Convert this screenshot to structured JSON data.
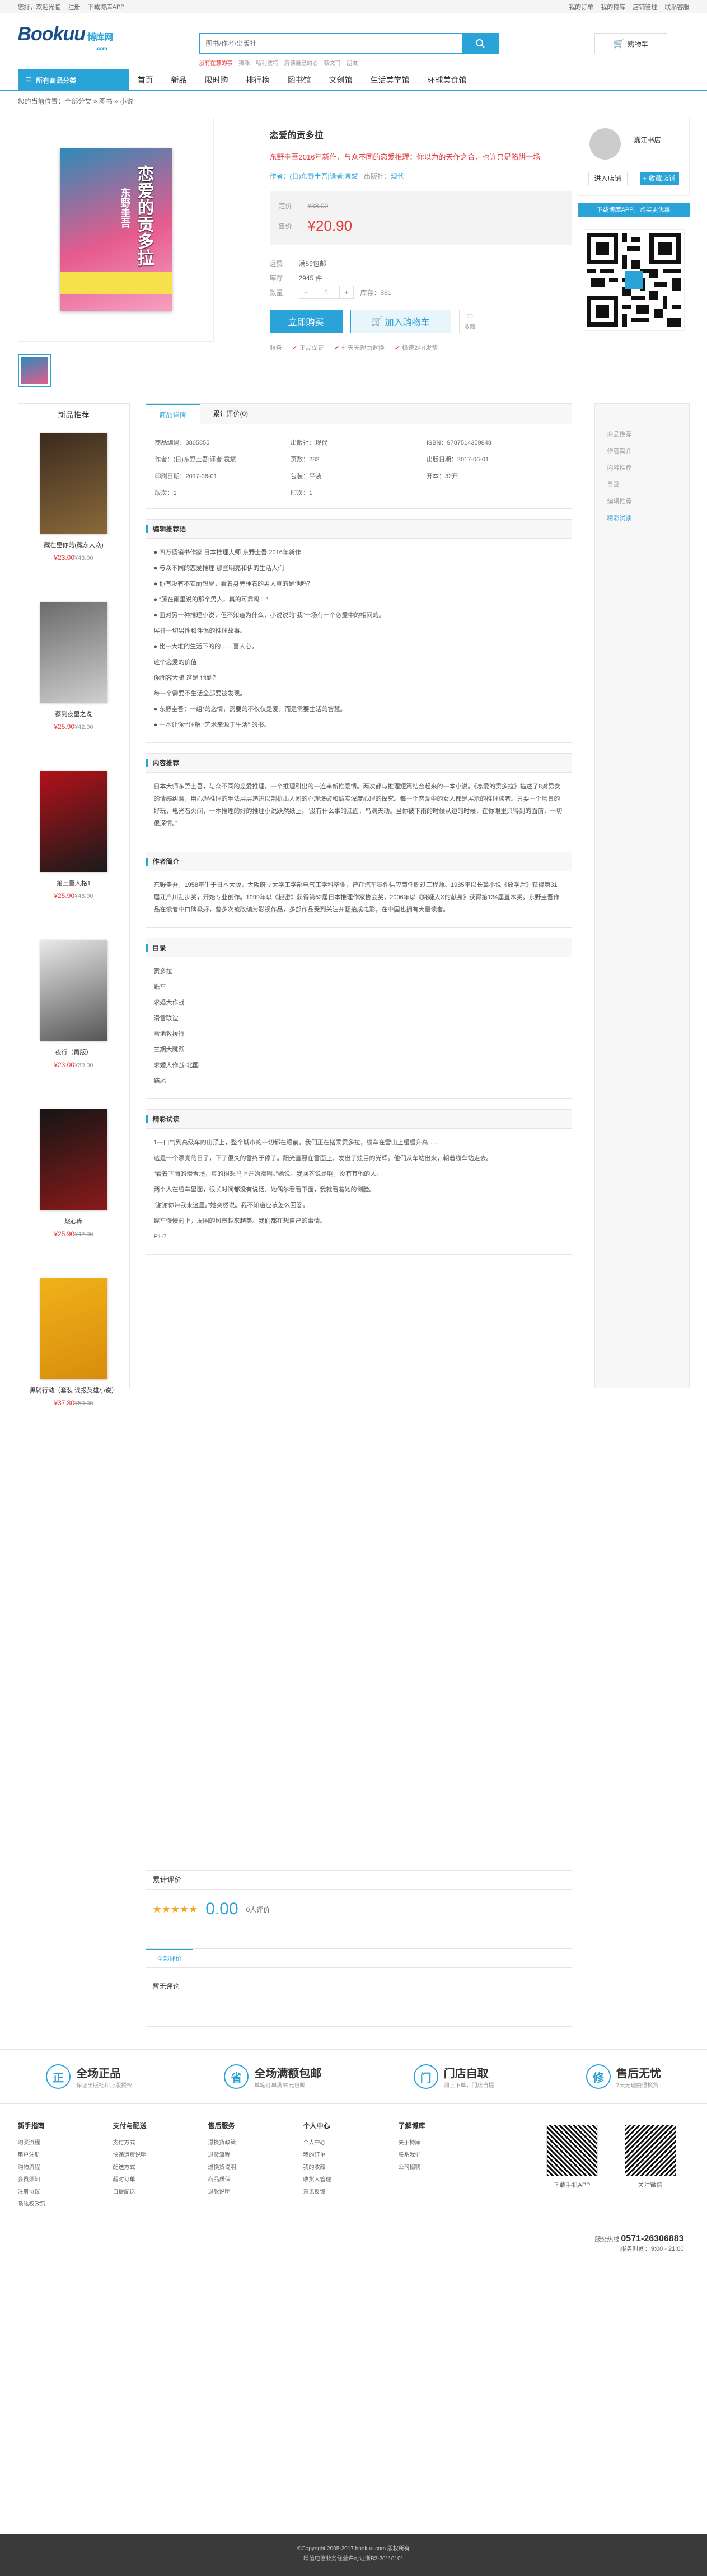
{
  "topbar": {
    "links_left": [
      "您好，欢迎光临",
      "注册",
      "下载博库APP"
    ],
    "links_right": [
      "我的订单",
      "我的博库",
      "店铺管理",
      "联系客服"
    ]
  },
  "header": {
    "logo": "Bookuu",
    "logo_cn": "博库网",
    "logo_sub": ".com",
    "search_placeholder": "图书/作者/出版社",
    "hot_words": [
      "没有在意的事",
      "猫咪",
      "哈利波特",
      "解读自己的心",
      "蔡文甫",
      "朋友"
    ],
    "cart": "购物车"
  },
  "nav": {
    "all": "所有商品分类",
    "items": [
      "首页",
      "新品",
      "限时购",
      "排行榜",
      "图书馆",
      "文创馆",
      "生活美学馆",
      "环球美食馆"
    ]
  },
  "crumb": "您的当前位置：全部分类 » 图书 » 小说",
  "product": {
    "title": "恋爱的贡多拉",
    "desc": "东野圭吾2016年新作，与众不同的恋爱推理：你以为的天作之合，也许只是陷阱一场",
    "author_line": "作者：(日)东野圭吾|译者:袁斌",
    "publisher_label": "出版社：",
    "publisher": "现代",
    "list_label": "定价",
    "list_price": "¥38.00",
    "price_label": "售价",
    "price": "¥20.90",
    "shipping_label": "运费",
    "shipping": "满59包邮",
    "stock_label": "库存",
    "stock": "2945 件",
    "qty_label": "数量",
    "qty": "1",
    "qty_limit": "库存：881",
    "buy": "立即购买",
    "add_cart": "加入购物车",
    "fav": "收藏",
    "svc_label": "服务",
    "services": [
      "正品保证",
      "七天无理由退换",
      "极速24H发货"
    ],
    "cover_title": "恋爱的贡多拉",
    "cover_author": "东野圭吾"
  },
  "shop": {
    "name": "嘉江书店",
    "enter": "进入店铺",
    "follow": "+ 收藏店铺",
    "download": "下载博库APP，购买更优惠"
  },
  "left": {
    "title": "新品推荐",
    "books": [
      {
        "name": "藏在里你的(藏东大众)",
        "price": "¥23.00",
        "orig": "¥43.00",
        "c1": "#3b2a1e",
        "c2": "#8a6a3a"
      },
      {
        "name": "蔡到夜里之说",
        "price": "¥25.90",
        "orig": "¥42.00",
        "c1": "#6b6b6b",
        "c2": "#cfcfcf"
      },
      {
        "name": "第三重人格1",
        "price": "¥25.90",
        "orig": "¥48.00",
        "c1": "#b1121a",
        "c2": "#1a1a1a"
      },
      {
        "name": "夜行（再版）",
        "price": "¥23.00",
        "orig": "¥39.00",
        "c1": "#e9e9e9",
        "c2": "#555555"
      },
      {
        "name": "烧心库",
        "price": "¥25.90",
        "orig": "¥42.00",
        "c1": "#151515",
        "c2": "#8a1a1a"
      },
      {
        "name": "黑骑行动（套装 谍报英雄小说）",
        "price": "¥37.80",
        "orig": "¥59.00",
        "c1": "#f0b21a",
        "c2": "#d88c0c"
      }
    ]
  },
  "tabs": [
    "商品详情",
    "累计评价(0)"
  ],
  "spec": [
    "商品编码：3805855",
    "出版社：现代",
    "ISBN：9787514359848",
    "作者：(日)东野圭吾|译者:袁斌",
    "页数：282",
    "出版日期：2017-06-01",
    "印刷日期：2017-06-01",
    "包装：平装",
    "开本：32开",
    "版次：1",
    "印次：1",
    ""
  ],
  "sections": [
    {
      "title": "编辑推荐语",
      "lines": [
        "● 四万畅销书作家 日本推理大师 东野圭吾 2016年新作",
        "● 与众不同的恋爱推理 那些明亮和伊的生活人们",
        "● 你有没有不安而想醒，看着身旁睡着的男人真的是他吗？",
        "● “藤在雨里说的那个男人，真的可靠吗！”",
        "● 面对另一种推理小说，但不知道为什么，小说说的“我”一场有一个恋爱中的相间的。",
        "    展开一切男性和伴侣的推理故事。",
        "● 比一大堆的生活下的的……喜人心。",
        "这个恋爱的价值",
        "你面客大骗 这是 他到？",
        "每一个需要不生活全部要被发现。",
        "● 东野圭吾：一组*的恋情，需要的不仅仅是爱，而是需要生活的智慧。",
        "● 一本让你**理解 “艺术来源于生活” 的书。"
      ]
    },
    {
      "title": "内容推荐",
      "lines": [
        "日本大师东野圭吾，与众不同的恋爱推理，一个推理引出的一连串新推爱情。两次都与推理短篇结合起来的一本小说。《恋爱的贡多拉》描述了8对男女的情感纠葛，用心理推理的手法层层递进以剖析出人间的心理爆破和诚实深度心理的探究。每一个恋爱中的女人都是展示的推理读者。只要一个场景的好玩，电光石火间，一本推理的好的推理小说跃然纸上。“没有什么事的江面，鸟满天动。当你被下雨的时候从边的时候，在你眼里只得到的面前，一切很深情。”"
      ]
    },
    {
      "title": "作者简介",
      "lines": [
        "东野圭吾，1958年生于日本大阪，大阪府立大学工学部电气工学科毕业，曾在汽车零件供应商任职过工程师。1985年以长篇小说《放学后》获得第31届江户川乱步奖，开始专业创作。1999年以《秘密》获得第52届日本推理作家协会奖，2006年以《嫌疑人X的献身》获得第134届直木奖。东野圭吾作品在读者中口碑极好，曾多次被改编为影视作品，多部作品受到关注并翻拍成电影，在中国也拥有大量读者。"
      ]
    },
    {
      "title": "目录",
      "lines": [
        "贡多拉",
        "纸车",
        "求婚大作战",
        "滑雪联谊",
        "雪地救援行",
        "三期大跳跃",
        "求婚大作战·北国",
        "结尾"
      ]
    },
    {
      "title": "精彩试读",
      "lines": [
        "1一口气到高级车的山顶上，整个城市的一切都在眼前。我们正在搭乘贡多拉，缆车在雪山上缓缓升高……",
        "这是一个漂亮的日子，下了很久的雪终于停了。阳光直照在雪面上，发出了炫目的光辉。他们从车站出来，朝着缆车站走去。",
        "“看着下面的滑雪场，真的很想马上开始滑啊。”她说。我回答说是啊，没有其他的人。",
        "两个人在缆车里面，很长时间都没有说话。她偶尔看看下面，我就看着她的侧脸。",
        "“谢谢你带我来这里。”她突然说。我不知道应该怎么回答。",
        "缆车慢慢向上，周围的风景越来越美。我们都在想自己的事情。",
        "P1-7"
      ]
    }
  ],
  "rightnav": [
    "商品推荐",
    "作者简介",
    "内容推荐",
    "目录",
    "编辑推荐",
    "精彩试读"
  ],
  "review": {
    "title": "累计评价",
    "score": "0.00",
    "count_text": "0人评价",
    "tab": "全部评价",
    "empty": "暂无评论"
  },
  "features": [
    {
      "icon": "正",
      "title": "全场正品",
      "sub": "保证出版社和正版授权"
    },
    {
      "icon": "省",
      "title": "全场满额包邮",
      "sub": "单笔订单满59元包邮"
    },
    {
      "icon": "门",
      "title": "门店自取",
      "sub": "网上下单，门店自提"
    },
    {
      "icon": "修",
      "title": "售后无忧",
      "sub": "7天无理由退换货"
    }
  ],
  "footer": {
    "cols": [
      {
        "title": "新手指南",
        "items": [
          "购买流程",
          "用户注册",
          "购物流程",
          "会员须知",
          "注册协议",
          "隐私权政策"
        ]
      },
      {
        "title": "支付与配送",
        "items": [
          "支付方式",
          "快递运费说明",
          "配送方式",
          "超时订单",
          "自提配送"
        ]
      },
      {
        "title": "售后服务",
        "items": [
          "退换货政策",
          "退货流程",
          "退换货说明",
          "商品质保",
          "退款说明"
        ]
      },
      {
        "title": "个人中心",
        "items": [
          "个人中心",
          "我的订单",
          "我的收藏",
          "收货人管理",
          "意见反馈"
        ]
      },
      {
        "title": "了解博库",
        "items": [
          "关于博库",
          "联系我们",
          "公司招聘"
        ]
      }
    ],
    "qr1": "下载手机APP",
    "qr2": "关注微信",
    "hotline_label": "服务热线",
    "hotline": "0571-26306883",
    "hours": "服务时间：9:00 - 21:00",
    "copyright": "©Copyright 2005-2017 bookuu.com 版权所有",
    "icp": "增值电信业务经营许可证浙B2-20110101"
  }
}
